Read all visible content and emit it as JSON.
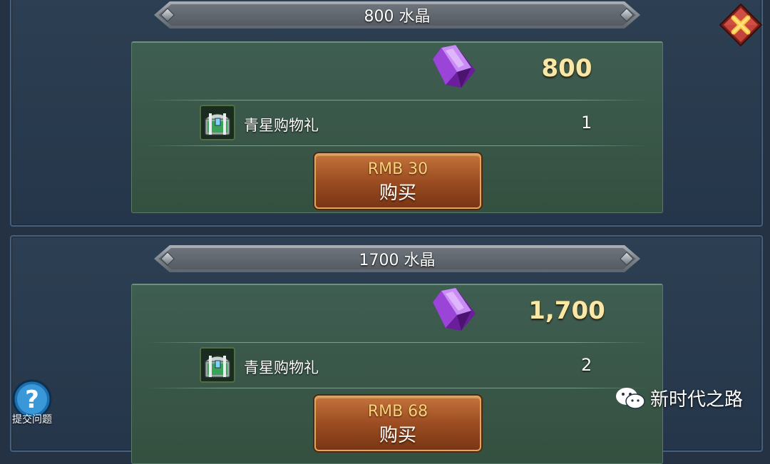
{
  "offers": [
    {
      "header": "800 水晶",
      "amount": "800",
      "gift_name": "青星购物礼",
      "gift_count": "1",
      "price": "RMB 30",
      "buy_label": "购买"
    },
    {
      "header": "1700 水晶",
      "amount": "1,700",
      "gift_name": "青星购物礼",
      "gift_count": "2",
      "price": "RMB 68",
      "buy_label": "购买"
    }
  ],
  "help": {
    "label": "提交问题"
  },
  "watermark": {
    "text": "新时代之路"
  },
  "icons": {
    "crystal": "purple-crystal-icon",
    "chest": "treasure-chest-icon",
    "close": "close-icon",
    "help": "question-mark-icon",
    "watermark": "wechat-icon"
  },
  "colors": {
    "background": "#243243",
    "card": "#3f5e52",
    "amount_text": "#f8e7a6",
    "button": "#9c4d22",
    "price_text": "#fbd27a",
    "close_button": "#b5352a"
  }
}
